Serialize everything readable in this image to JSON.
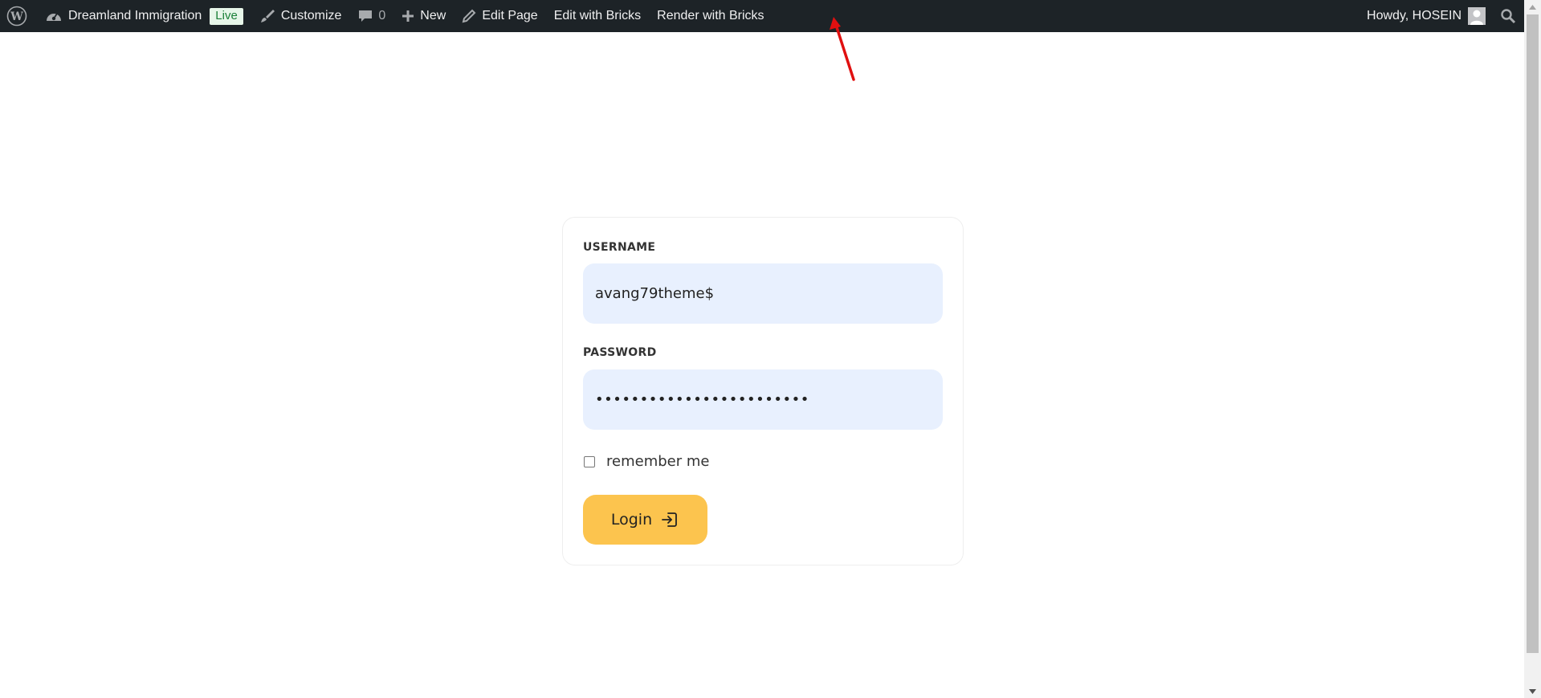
{
  "adminbar": {
    "site_name": "Dreamland Immigration",
    "live_badge": "Live",
    "customize": "Customize",
    "comments_count": "0",
    "new": "New",
    "edit_page": "Edit Page",
    "edit_with_bricks": "Edit with Bricks",
    "render_with_bricks": "Render with Bricks",
    "howdy": "Howdy, HOSEIN"
  },
  "login": {
    "username_label": "USERNAME",
    "username_value": "avang79theme$",
    "password_label": "PASSWORD",
    "password_value": "••••••••••••••••••••••••",
    "remember_label": "remember me",
    "login_button": "Login"
  },
  "colors": {
    "adminbar_bg": "#1d2327",
    "input_bg": "#e8f0fe",
    "button_bg": "#fcc44e",
    "annotation_arrow": "#e01010"
  }
}
